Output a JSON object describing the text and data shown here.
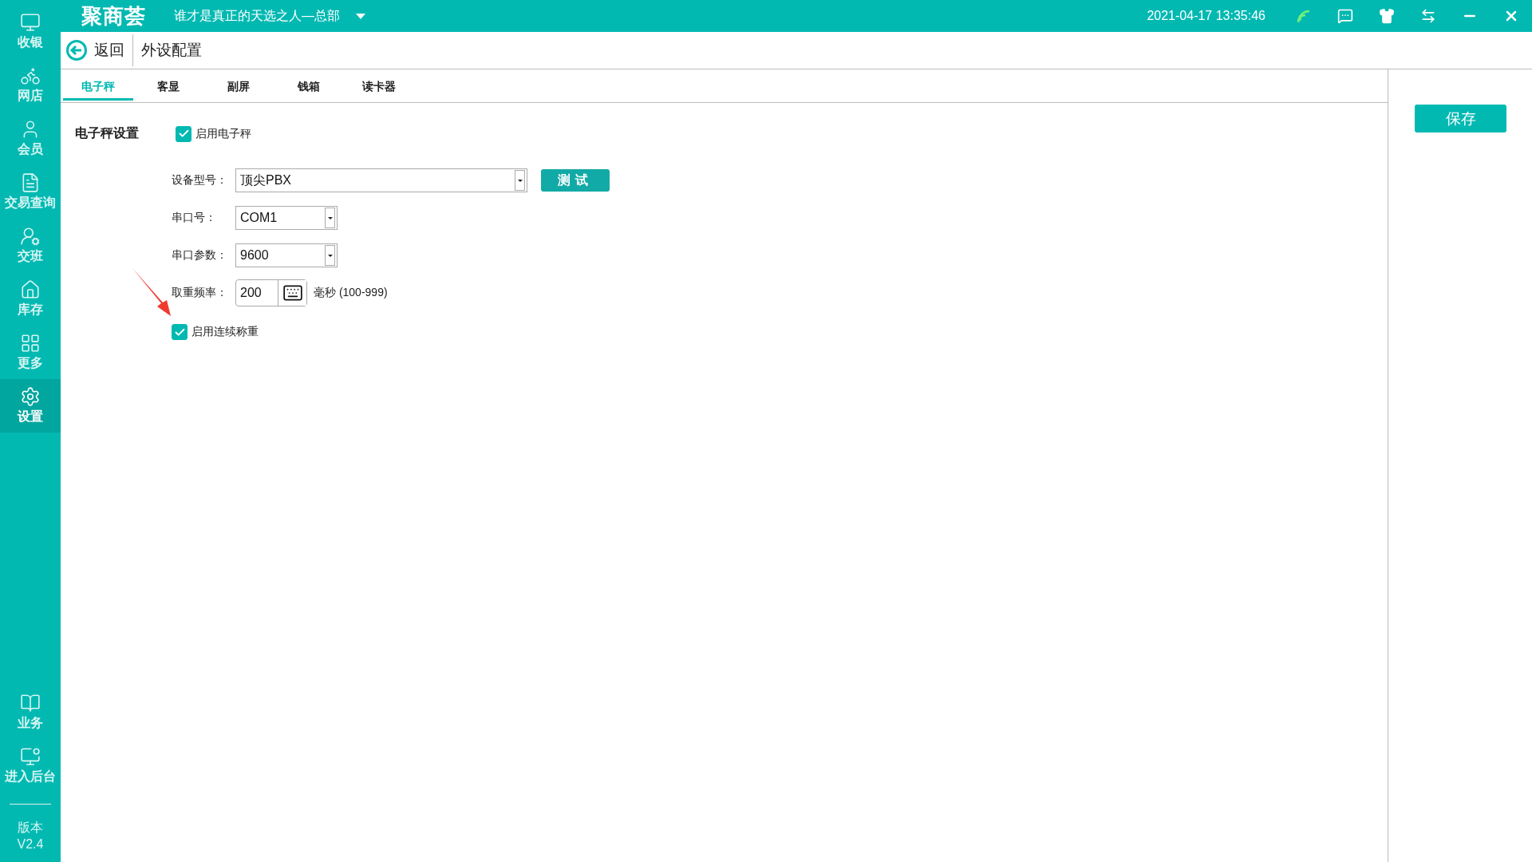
{
  "app": {
    "logo": "聚商荟",
    "store": "谁才是真正的天选之人—总部",
    "datetime": "2021-04-17 13:35:46"
  },
  "sidebar": {
    "items": [
      {
        "label": "收银",
        "selected": false
      },
      {
        "label": "网店",
        "selected": false
      },
      {
        "label": "会员",
        "selected": false
      },
      {
        "label": "交易查询",
        "selected": false
      },
      {
        "label": "交班",
        "selected": false
      },
      {
        "label": "库存",
        "selected": false
      },
      {
        "label": "更多",
        "selected": false
      },
      {
        "label": "设置",
        "selected": true
      }
    ],
    "bottom_items": [
      {
        "label": "业务"
      },
      {
        "label": "进入后台"
      }
    ],
    "version": {
      "label": "版本",
      "value": "V2.4"
    }
  },
  "page": {
    "back": "返回",
    "title": "外设配置"
  },
  "tabs": [
    {
      "label": "电子秤",
      "selected": true
    },
    {
      "label": "客显",
      "selected": false
    },
    {
      "label": "副屏",
      "selected": false
    },
    {
      "label": "钱箱",
      "selected": false
    },
    {
      "label": "读卡器",
      "selected": false
    }
  ],
  "section": {
    "title": "电子秤设置",
    "enable": {
      "label": "启用电子秤",
      "checked": true
    }
  },
  "fields": [
    {
      "kind": "select",
      "label": "设备型号：",
      "value": "顶尖PBX",
      "button": "测试"
    },
    {
      "kind": "select",
      "label": "串口号：",
      "value": "COM1"
    },
    {
      "kind": "select",
      "label": "串口参数：",
      "value": "9600"
    },
    {
      "kind": "number",
      "label": "取重频率：",
      "value": "200",
      "hint": "毫秒 (100-999)"
    }
  ],
  "continuous": {
    "label": "启用连续称重",
    "checked": true
  },
  "save": "保存"
}
